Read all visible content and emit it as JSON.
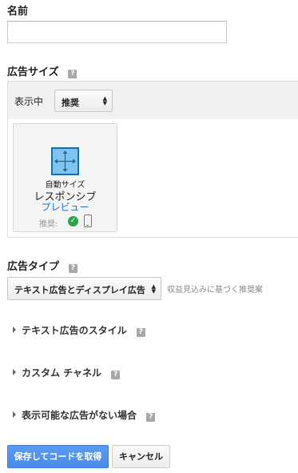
{
  "name_section": {
    "label": "名前",
    "value": "",
    "placeholder": ""
  },
  "ad_size": {
    "label": "広告サイズ",
    "help": "?",
    "showing_label": "表示中",
    "showing_select": "推奨",
    "card": {
      "line1": "自動サイズ",
      "line2": "レスポンシブ",
      "preview_link": "プレビュー",
      "recommended_label": "推奨:",
      "check_glyph": "✓"
    }
  },
  "ad_type": {
    "label": "広告タイプ",
    "help": "?",
    "select_value": "テキスト広告とディスプレイ広告",
    "hint": "収益見込みに基づく推奨案"
  },
  "collapsibles": [
    {
      "label": "テキスト広告のスタイル",
      "help": "?"
    },
    {
      "label": "カスタム チャネル",
      "help": "?"
    },
    {
      "label": "表示可能な広告がない場合",
      "help": "?"
    }
  ],
  "buttons": {
    "save": "保存してコードを取得",
    "cancel": "キャンセル"
  },
  "colors": {
    "accent": "#4a8bea",
    "link": "#1a73c8",
    "success": "#2aa44a",
    "icon_fill": "#82c3ef"
  },
  "icons": {
    "resize": "arrows-move-icon",
    "check": "check-circle-icon",
    "phone": "smartphone-icon",
    "help": "help-icon"
  }
}
